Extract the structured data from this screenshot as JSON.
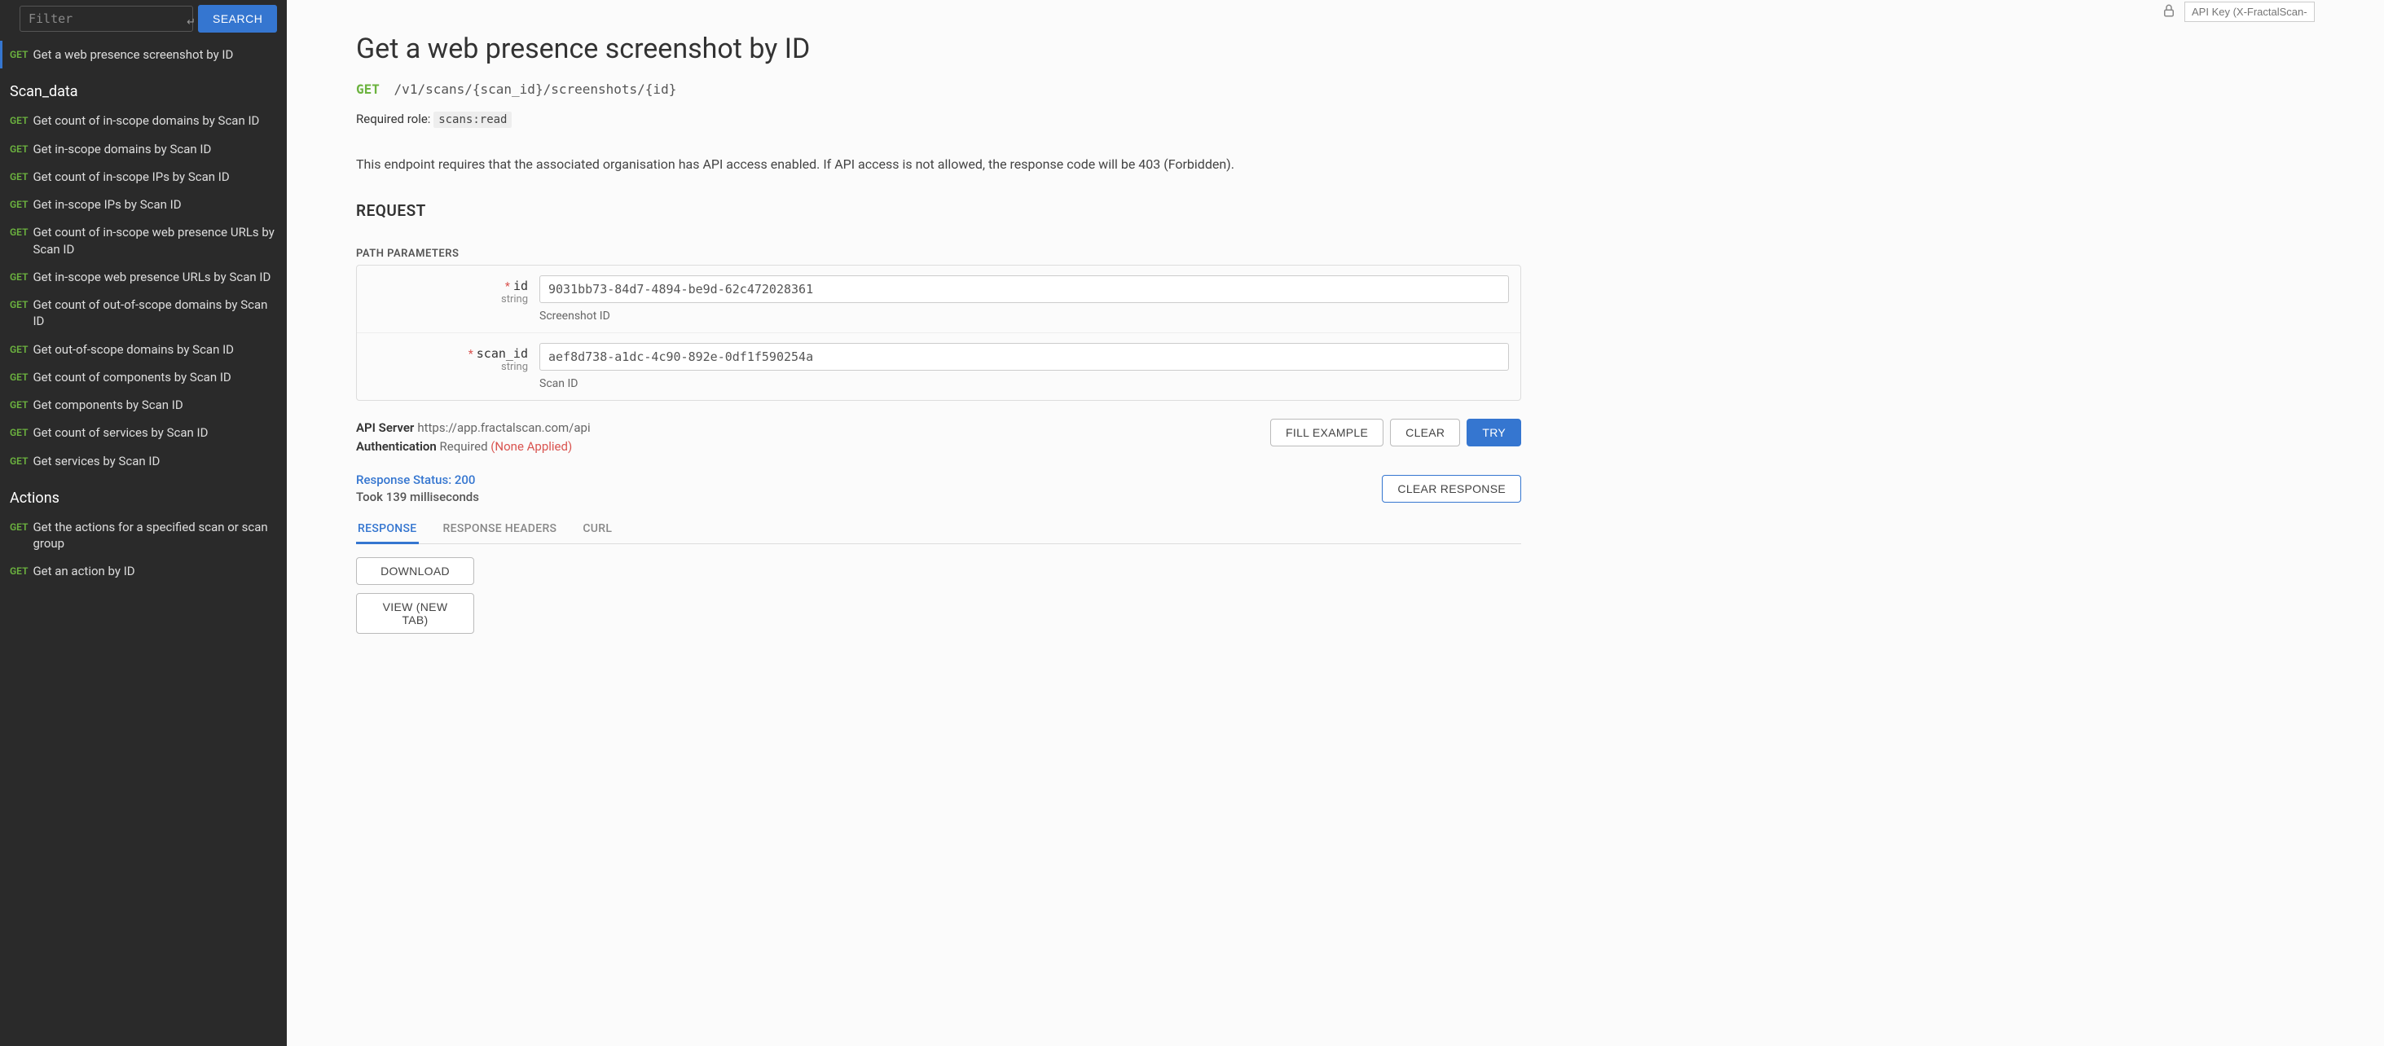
{
  "sidebar": {
    "filter_placeholder": "Filter",
    "enter_symbol": "↵",
    "search_label": "SEARCH",
    "top_item": {
      "method": "GET",
      "label": "Get a web presence screenshot by ID"
    },
    "sections": [
      {
        "title": "Scan_data",
        "items": [
          {
            "method": "GET",
            "label": "Get count of in-scope domains by Scan ID"
          },
          {
            "method": "GET",
            "label": "Get in-scope domains by Scan ID"
          },
          {
            "method": "GET",
            "label": "Get count of in-scope IPs by Scan ID"
          },
          {
            "method": "GET",
            "label": "Get in-scope IPs by Scan ID"
          },
          {
            "method": "GET",
            "label": "Get count of in-scope web presence URLs by Scan ID"
          },
          {
            "method": "GET",
            "label": "Get in-scope web presence URLs by Scan ID"
          },
          {
            "method": "GET",
            "label": "Get count of out-of-scope domains by Scan ID"
          },
          {
            "method": "GET",
            "label": "Get out-of-scope domains by Scan ID"
          },
          {
            "method": "GET",
            "label": "Get count of components by Scan ID"
          },
          {
            "method": "GET",
            "label": "Get components by Scan ID"
          },
          {
            "method": "GET",
            "label": "Get count of services by Scan ID"
          },
          {
            "method": "GET",
            "label": "Get services by Scan ID"
          }
        ]
      },
      {
        "title": "Actions",
        "items": [
          {
            "method": "GET",
            "label": "Get the actions for a specified scan or scan group"
          },
          {
            "method": "GET",
            "label": "Get an action by ID"
          }
        ]
      }
    ]
  },
  "topbar": {
    "api_key_placeholder": "API Key (X-FractalScan-A..."
  },
  "main": {
    "title": "Get a web presence screenshot by ID",
    "method": "GET",
    "path": "/v1/scans/{scan_id}/screenshots/{id}",
    "role_label": "Required role:",
    "role_value": "scans:read",
    "description": "This endpoint requires that the associated organisation has API access enabled. If API access is not allowed, the response code will be 403 (Forbidden).",
    "request_heading": "REQUEST",
    "path_params_label": "PATH PARAMETERS",
    "params": [
      {
        "name": "id",
        "type": "string",
        "required": true,
        "value": "9031bb73-84d7-4894-be9d-62c472028361",
        "description": "Screenshot ID"
      },
      {
        "name": "scan_id",
        "type": "string",
        "required": true,
        "value": "aef8d738-a1dc-4c90-892e-0df1f590254a",
        "description": "Scan ID"
      }
    ],
    "server_label": "API Server",
    "server_value": "https://app.fractalscan.com/api",
    "auth_label": "Authentication",
    "auth_required": "Required",
    "auth_none": "(None Applied)",
    "fill_example": "FILL EXAMPLE",
    "clear": "CLEAR",
    "try": "TRY",
    "status_line": "Response Status: 200",
    "time_line": "Took 139 milliseconds",
    "clear_response": "CLEAR RESPONSE",
    "tabs": [
      "RESPONSE",
      "RESPONSE HEADERS",
      "CURL"
    ],
    "download": "DOWNLOAD",
    "view_new_tab": "VIEW (NEW TAB)"
  }
}
